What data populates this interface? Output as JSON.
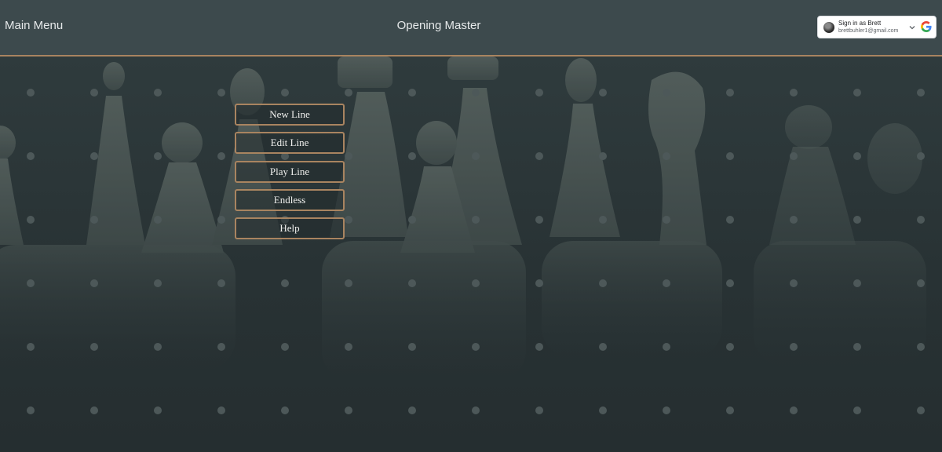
{
  "header": {
    "left_title": "Main Menu",
    "app_title": "Opening Master"
  },
  "signin": {
    "title": "Sign in as Brett",
    "email": "brettbuhler1@gmail.com",
    "avatar_icon": "user-avatar-icon",
    "chevron_icon": "chevron-down-icon",
    "provider_icon": "google-g-icon"
  },
  "menu": {
    "items": [
      {
        "label": "New Line"
      },
      {
        "label": "Edit Line"
      },
      {
        "label": "Play Line"
      },
      {
        "label": "Endless"
      },
      {
        "label": "Help"
      }
    ]
  },
  "colors": {
    "header_bg": "#3d4a4d",
    "accent_border": "#a98460",
    "page_bg": "#2b3537",
    "text_light": "#e6e9ea"
  }
}
